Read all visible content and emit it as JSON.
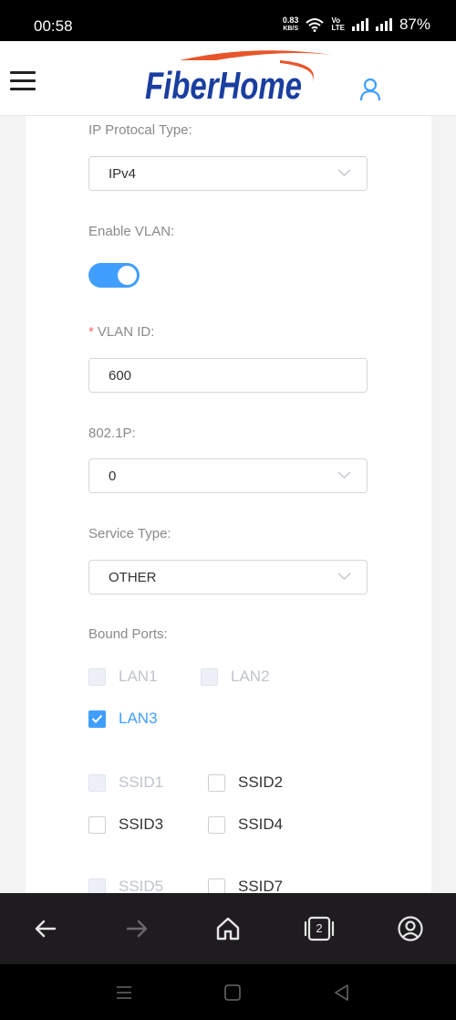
{
  "status_bar": {
    "time": "00:58",
    "net_speed_value": "0.83",
    "net_speed_unit": "KB/S",
    "volte_top": "Vo",
    "volte_bottom": "LTE",
    "battery": "87%"
  },
  "header": {
    "logo_text": "FiberHome",
    "brand_color": "#1a3ea0",
    "swoosh_color": "#e8552a"
  },
  "form": {
    "ip_protocol_label": "IP Protocal Type:",
    "ip_protocol_value": "IPv4",
    "enable_vlan_label": "Enable VLAN:",
    "enable_vlan_on": true,
    "vlan_id_required_mark": "*",
    "vlan_id_label": "VLAN ID:",
    "vlan_id_value": "600",
    "priority_label": "802.1P:",
    "priority_value": "0",
    "service_type_label": "Service Type:",
    "service_type_value": "OTHER",
    "bound_ports_label": "Bound Ports:",
    "ports": {
      "lan1": "LAN1",
      "lan2": "LAN2",
      "lan3": "LAN3",
      "ssid1": "SSID1",
      "ssid2": "SSID2",
      "ssid3": "SSID3",
      "ssid4": "SSID4",
      "ssid5": "SSID5",
      "ssid7": "SSID7"
    },
    "accent_color": "#409eff"
  },
  "browser_bar": {
    "tab_count": "2"
  }
}
